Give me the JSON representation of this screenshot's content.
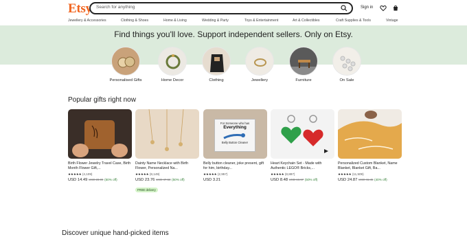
{
  "header": {
    "logo": "Etsy",
    "search_placeholder": "Search for anything",
    "signin": "Sign in"
  },
  "nav": [
    "Jewellery & Accessories",
    "Clothing & Shoes",
    "Home & Living",
    "Wedding & Party",
    "Toys & Entertainment",
    "Art & Collectibles",
    "Craft Supplies & Tools",
    "Vintage"
  ],
  "hero": {
    "title": "Find things you'll love. Support independent sellers. Only on Etsy."
  },
  "categories": [
    "Personalised Gifts",
    "Home Decor",
    "Clothing",
    "Jewellery",
    "Furniture",
    "On Sale"
  ],
  "popular": {
    "title": "Popular gifts right now",
    "items": [
      {
        "title": "Birth Flower Jewelry Travel Case, Birth Month Flower Gift,...",
        "rating": "(4,109)",
        "price": "USD 14.49",
        "old": "USD 28.99",
        "off": "(50% off)",
        "badge": ""
      },
      {
        "title": "Dainty Name Necklace with Birth Flower, Personalized Na...",
        "rating": "(8,149)",
        "price": "USD 23.76",
        "old": "USD 47.53",
        "off": "(50% off)",
        "badge": "FREE delivery"
      },
      {
        "title": "Belly button cleaner, joke present, gift for him, birthday...",
        "rating": "(2,957)",
        "price": "USD 3.21",
        "old": "",
        "off": "",
        "badge": ""
      },
      {
        "title": "Heart Keychain Set - Made with Authentic LEGO® Bricks,...",
        "rating": "(8,887)",
        "price": "USD 8.48",
        "old": "USD 16.97",
        "off": "(50% off)",
        "badge": ""
      },
      {
        "title": "Personalized Custom Blanket, Name Blanket, Blanket Gift, Ba...",
        "rating": "(11,509)",
        "price": "USD 24.87",
        "old": "USD 41.45",
        "off": "(40% off)",
        "badge": ""
      }
    ],
    "stars": "★★★★★",
    "card3_text": [
      "For Someone who has",
      "Everything",
      "Belly Button Cleaner"
    ]
  },
  "discover": {
    "title": "Discover unique hand-picked items"
  },
  "colors": {
    "brand": "#f1641e",
    "hero_bg": "#dcebdc"
  }
}
